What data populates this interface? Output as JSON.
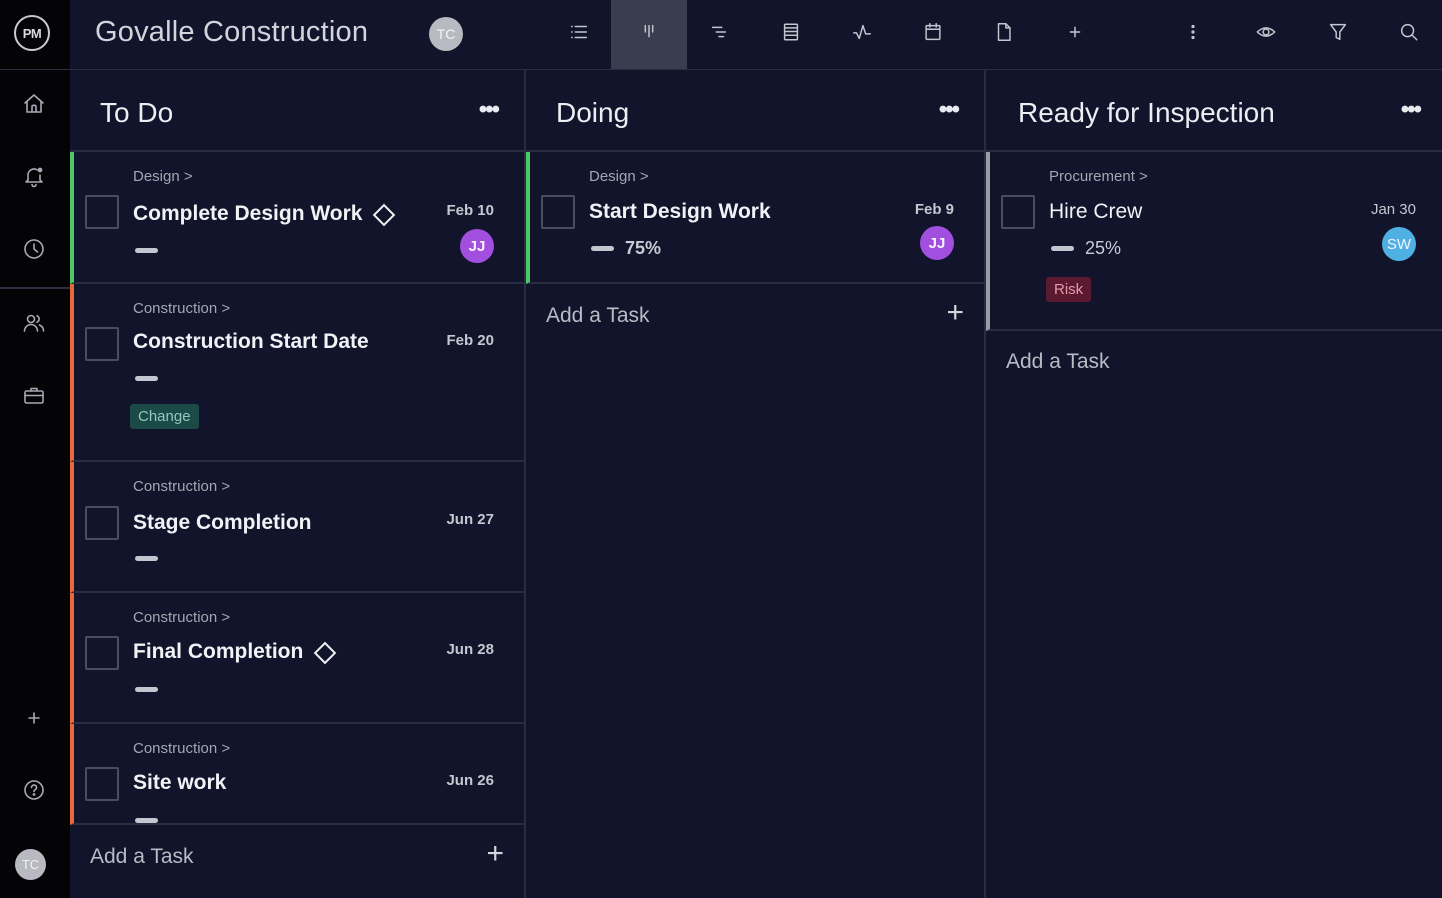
{
  "app": {
    "logo_text": "PM",
    "project_title": "Govalle Construction",
    "project_avatar_initials": "TC",
    "user_avatar_initials": "TC"
  },
  "sidebar": {
    "items": [
      {
        "name": "home",
        "icon": "home-icon"
      },
      {
        "name": "notifications",
        "icon": "bell-icon"
      },
      {
        "name": "timesheets",
        "icon": "clock-icon"
      },
      {
        "name": "team",
        "icon": "users-icon"
      },
      {
        "name": "portfolio",
        "icon": "briefcase-icon"
      },
      {
        "name": "add",
        "icon": "plus-icon"
      },
      {
        "name": "help",
        "icon": "help-icon"
      }
    ]
  },
  "toolbar": {
    "views": [
      {
        "name": "list-view",
        "icon": "list-icon",
        "active": false
      },
      {
        "name": "board-view",
        "icon": "board-icon",
        "active": true
      },
      {
        "name": "gantt-view",
        "icon": "gantt-icon",
        "active": false
      },
      {
        "name": "sheet-view",
        "icon": "sheet-icon",
        "active": false
      },
      {
        "name": "dashboard-view",
        "icon": "pulse-icon",
        "active": false
      },
      {
        "name": "calendar-view",
        "icon": "calendar-icon",
        "active": false
      },
      {
        "name": "files-view",
        "icon": "file-icon",
        "active": false
      },
      {
        "name": "add-view",
        "icon": "plus-icon",
        "active": false
      }
    ],
    "actions": [
      {
        "name": "more-options",
        "icon": "vertical-dots-icon"
      },
      {
        "name": "watch",
        "icon": "eye-icon"
      },
      {
        "name": "filter",
        "icon": "filter-icon"
      },
      {
        "name": "search",
        "icon": "search-icon"
      }
    ]
  },
  "colors": {
    "green_status": "#4fc767",
    "orange_status": "#e9683a",
    "gray_status": "#9a9ca8",
    "avatar_jj": "#a24fe0",
    "avatar_sw": "#4fb0e3",
    "tag_change_bg": "#1c4a47",
    "tag_change_text": "#8fc9bf",
    "tag_risk_bg": "#5c1a30",
    "tag_risk_text": "#e29aad"
  },
  "columns": [
    {
      "title": "To Do",
      "more_label": "•••",
      "add_task_label": "Add a Task",
      "add_task_plus": "+",
      "tasks": [
        {
          "crumb": "Design >",
          "name": "Complete Design Work",
          "milestone": true,
          "date": "Feb 10",
          "assignee": "JJ",
          "progress": null,
          "tag": null,
          "status": "green"
        },
        {
          "crumb": "Construction >",
          "name": "Construction Start Date",
          "milestone": false,
          "date": "Feb 20",
          "assignee": null,
          "progress": null,
          "tag": "Change",
          "status": "orange"
        },
        {
          "crumb": "Construction >",
          "name": "Stage Completion",
          "milestone": false,
          "date": "Jun 27",
          "assignee": null,
          "progress": null,
          "tag": null,
          "status": "orange"
        },
        {
          "crumb": "Construction >",
          "name": "Final Completion",
          "milestone": true,
          "date": "Jun 28",
          "assignee": null,
          "progress": null,
          "tag": null,
          "status": "orange"
        },
        {
          "crumb": "Construction >",
          "name": "Site work",
          "milestone": false,
          "date": "Jun 26",
          "assignee": null,
          "progress": null,
          "tag": null,
          "status": "orange"
        }
      ]
    },
    {
      "title": "Doing",
      "more_label": "•••",
      "add_task_label": "Add a Task",
      "add_task_plus": "+",
      "tasks": [
        {
          "crumb": "Design >",
          "name": "Start Design Work",
          "milestone": false,
          "date": "Feb 9",
          "assignee": "JJ",
          "progress": "75%",
          "tag": null,
          "status": "green"
        }
      ]
    },
    {
      "title": "Ready for Inspection",
      "more_label": "•••",
      "add_task_label": "Add a Task",
      "tasks": [
        {
          "crumb": "Procurement >",
          "name": "Hire Crew",
          "milestone": false,
          "date": "Jan 30",
          "assignee": "SW",
          "progress": "25%",
          "tag": "Risk",
          "status": "gray"
        }
      ]
    }
  ]
}
